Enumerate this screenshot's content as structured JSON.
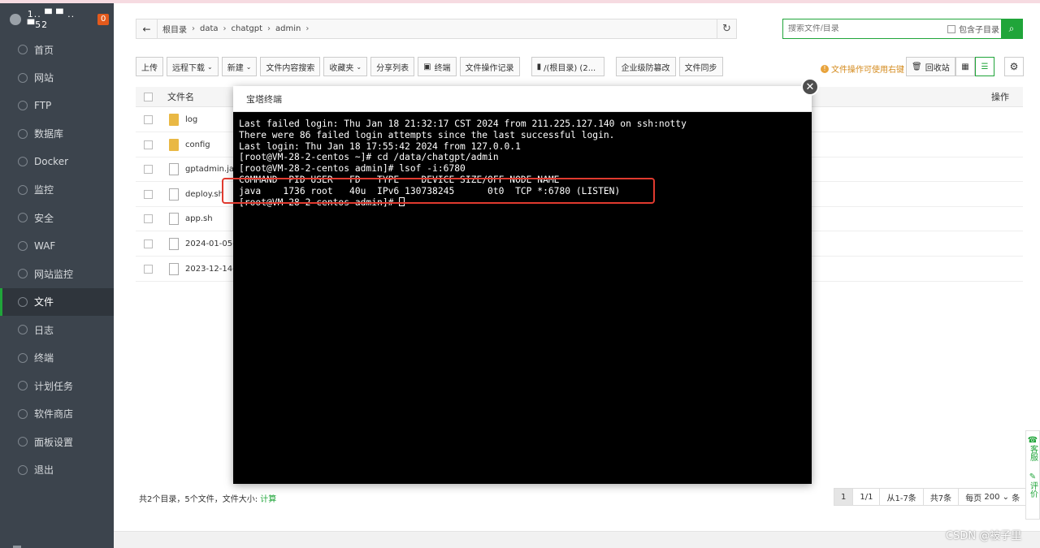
{
  "brand": {
    "ip": "1.. ▀ ▀ .. ▀52",
    "badge": "0"
  },
  "sidebar": {
    "items": [
      {
        "label": "首页",
        "icon": "home-icon"
      },
      {
        "label": "网站",
        "icon": "globe-icon"
      },
      {
        "label": "FTP",
        "icon": "ftp-icon"
      },
      {
        "label": "数据库",
        "icon": "database-icon"
      },
      {
        "label": "Docker",
        "icon": "docker-icon"
      },
      {
        "label": "监控",
        "icon": "monitor-icon"
      },
      {
        "label": "安全",
        "icon": "shield-icon"
      },
      {
        "label": "WAF",
        "icon": "waf-icon"
      },
      {
        "label": "网站监控",
        "icon": "site-monitor-icon"
      },
      {
        "label": "文件",
        "icon": "folder-icon",
        "active": true
      },
      {
        "label": "日志",
        "icon": "log-icon"
      },
      {
        "label": "终端",
        "icon": "terminal-icon"
      },
      {
        "label": "计划任务",
        "icon": "clock-icon"
      },
      {
        "label": "软件商店",
        "icon": "store-icon"
      },
      {
        "label": "面板设置",
        "icon": "settings-icon"
      },
      {
        "label": "退出",
        "icon": "logout-icon"
      }
    ]
  },
  "path": {
    "crumbs": [
      "根目录",
      "data",
      "chatgpt",
      "admin"
    ]
  },
  "search": {
    "placeholder": "搜索文件/目录",
    "subdir_label": "包含子目录"
  },
  "toolbar": {
    "upload": "上传",
    "remote_download": "远程下载",
    "new": "新建",
    "content_search": "文件内容搜索",
    "favorites": "收藏夹",
    "share_list": "分享列表",
    "terminal": "终端",
    "op_log": "文件操作记录",
    "disk": "/(根目录) (2...",
    "tamper": "企业级防篡改",
    "sync": "文件同步"
  },
  "tip": "文件操作可使用右键",
  "recycle": "回收站",
  "table": {
    "col_name": "文件名",
    "col_ops": "操作",
    "rows": [
      {
        "name": "log",
        "type": "folder"
      },
      {
        "name": "config",
        "type": "folder"
      },
      {
        "name": "gptadmin.jar",
        "type": "file"
      },
      {
        "name": "deploy.sh",
        "type": "file"
      },
      {
        "name": "app.sh",
        "type": "file"
      },
      {
        "name": "2024-01-05-13",
        "type": "file"
      },
      {
        "name": "2023-12-14-13",
        "type": "file"
      }
    ]
  },
  "footer": {
    "summary": "共2个目录，5个文件，文件大小: ",
    "calc": "计算"
  },
  "pager": {
    "current": "1",
    "pages": "1/1",
    "range": "从1-7条",
    "total": "共7条",
    "per_page_label": "每页",
    "per_page": "200",
    "per_page_unit": "条"
  },
  "float": {
    "service": "客服",
    "review": "评价"
  },
  "watermark": "CSDN @被子里",
  "modal": {
    "title": "宝塔终端",
    "lines": [
      "Last failed login: Thu Jan 18 21:32:17 CST 2024 from 211.225.127.140 on ssh:notty",
      "There were 86 failed login attempts since the last successful login.",
      "Last login: Thu Jan 18 17:55:42 2024 from 127.0.0.1",
      "[root@VM-28-2-centos ~]# cd /data/chatgpt/admin",
      "[root@VM-28-2-centos admin]# lsof -i:6780",
      "COMMAND  PID USER   FD   TYPE    DEVICE SIZE/OFF NODE NAME",
      "java    1736 root   40u  IPv6 130738245      0t0  TCP *:6780 (LISTEN)",
      "[root@VM-28-2-centos admin]# "
    ]
  }
}
